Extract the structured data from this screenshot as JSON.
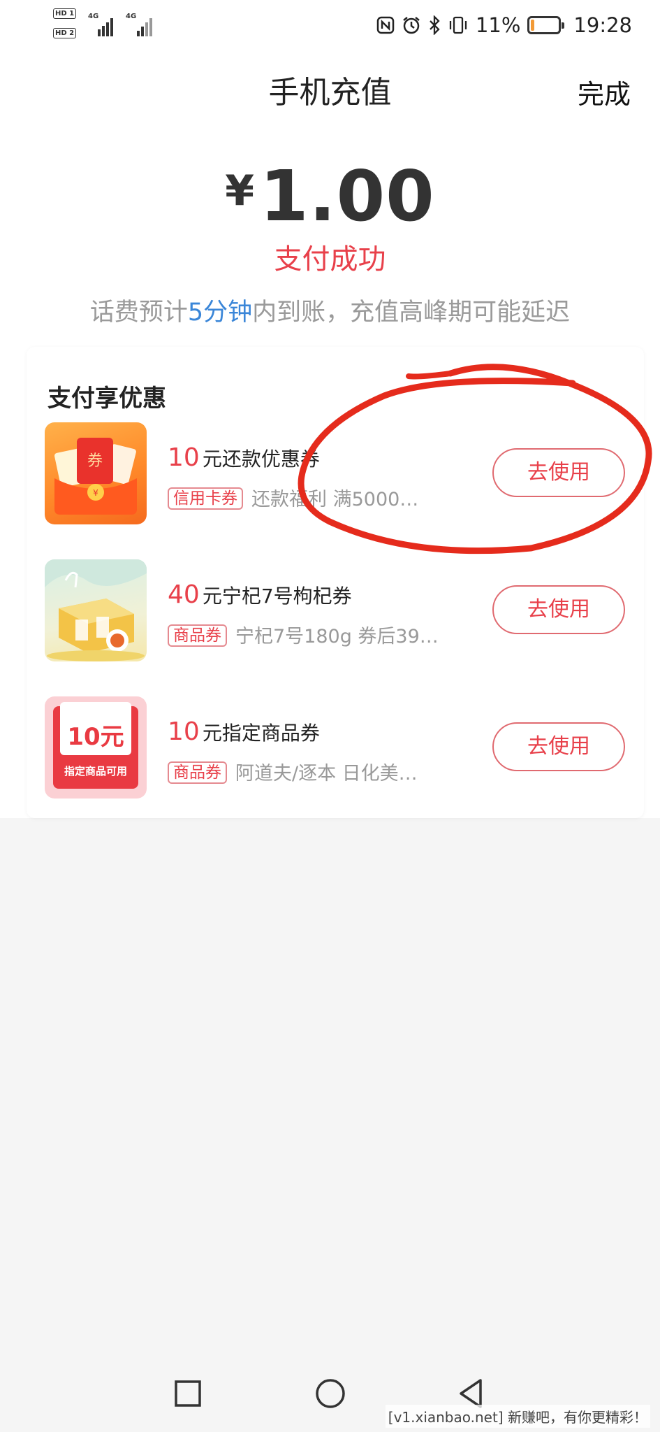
{
  "status_bar": {
    "hd1": "HD 1",
    "hd2": "HD 2",
    "net1": "4G",
    "net2": "4G",
    "battery_text": "11%",
    "battery_level": 0.11,
    "time": "19:28",
    "icons": [
      "nfc-icon",
      "alarm-icon",
      "bluetooth-icon",
      "vibrate-icon"
    ]
  },
  "header": {
    "title": "手机充值",
    "done_label": "完成"
  },
  "payment": {
    "currency": "¥",
    "amount": "1.00",
    "status": "支付成功",
    "notice_pre": "话费预计",
    "notice_highlight": "5分钟",
    "notice_post": "内到账，充值高峰期可能延迟"
  },
  "offers": {
    "title": "支付享优惠",
    "items": [
      {
        "num": "10",
        "name": "元还款优惠券",
        "tag": "信用卡券",
        "desc": "还款福利 满5000…",
        "button": "去使用",
        "icon": "red-envelope-icon"
      },
      {
        "num": "40",
        "name": "元宁杞7号枸杞券",
        "tag": "商品券",
        "desc": "宁杞7号180g 券后39…",
        "button": "去使用",
        "icon": "goji-box-icon"
      },
      {
        "num": "10",
        "name": "元指定商品券",
        "tag": "商品券",
        "desc": "阿道夫/逐本 日化美…",
        "button": "去使用",
        "icon": "voucher-icon",
        "thumb_value": "10元",
        "thumb_caption": "指定商品可用"
      }
    ]
  },
  "colors": {
    "accent_red": "#e8404a",
    "link_blue": "#3a86d8",
    "annotation_red": "#e52b1c"
  },
  "watermark": "[v1.xianbao.net] 新赚吧，有你更精彩！"
}
